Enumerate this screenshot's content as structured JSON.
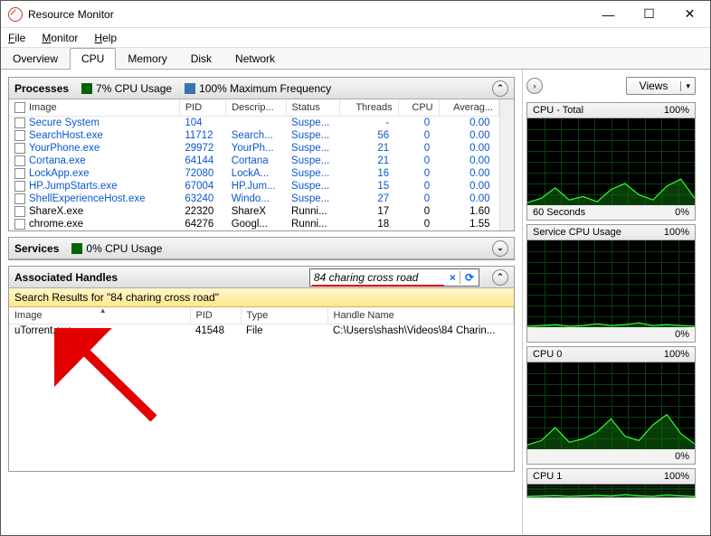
{
  "window": {
    "title": "Resource Monitor"
  },
  "menu": {
    "file": "File",
    "monitor": "Monitor",
    "help": "Help"
  },
  "tabs": {
    "overview": "Overview",
    "cpu": "CPU",
    "memory": "Memory",
    "disk": "Disk",
    "network": "Network"
  },
  "processes": {
    "title": "Processes",
    "cpu_usage_label": "7% CPU Usage",
    "max_freq_label": "100% Maximum Frequency",
    "cols": {
      "image": "Image",
      "pid": "PID",
      "desc": "Descrip...",
      "status": "Status",
      "threads": "Threads",
      "cpu": "CPU",
      "avg": "Averag..."
    },
    "rows": [
      {
        "image": "Secure System",
        "pid": "104",
        "desc": "",
        "status": "Suspe...",
        "threads": "-",
        "cpu": "0",
        "avg": "0.00",
        "link": true
      },
      {
        "image": "SearchHost.exe",
        "pid": "11712",
        "desc": "Search...",
        "status": "Suspe...",
        "threads": "56",
        "cpu": "0",
        "avg": "0.00",
        "link": true
      },
      {
        "image": "YourPhone.exe",
        "pid": "29972",
        "desc": "YourPh...",
        "status": "Suspe...",
        "threads": "21",
        "cpu": "0",
        "avg": "0.00",
        "link": true
      },
      {
        "image": "Cortana.exe",
        "pid": "64144",
        "desc": "Cortana",
        "status": "Suspe...",
        "threads": "21",
        "cpu": "0",
        "avg": "0.00",
        "link": true
      },
      {
        "image": "LockApp.exe",
        "pid": "72080",
        "desc": "LockA...",
        "status": "Suspe...",
        "threads": "16",
        "cpu": "0",
        "avg": "0.00",
        "link": true
      },
      {
        "image": "HP.JumpStarts.exe",
        "pid": "67004",
        "desc": "HP.Jum...",
        "status": "Suspe...",
        "threads": "15",
        "cpu": "0",
        "avg": "0.00",
        "link": true
      },
      {
        "image": "ShellExperienceHost.exe",
        "pid": "63240",
        "desc": "Windo...",
        "status": "Suspe...",
        "threads": "27",
        "cpu": "0",
        "avg": "0.00",
        "link": true
      },
      {
        "image": "ShareX.exe",
        "pid": "22320",
        "desc": "ShareX",
        "status": "Runni...",
        "threads": "17",
        "cpu": "0",
        "avg": "1.60",
        "link": false
      },
      {
        "image": "chrome.exe",
        "pid": "64276",
        "desc": "Googl...",
        "status": "Runni...",
        "threads": "18",
        "cpu": "0",
        "avg": "1.55",
        "link": false
      }
    ]
  },
  "services": {
    "title": "Services",
    "cpu_usage_label": "0% CPU Usage"
  },
  "handles": {
    "title": "Associated Handles",
    "search_value": "84 charing cross road",
    "results_label": "Search Results for \"84 charing cross road\"",
    "cols": {
      "image": "Image",
      "pid": "PID",
      "type": "Type",
      "name": "Handle Name"
    },
    "row": {
      "image": "uTorrent.exe",
      "pid": "41548",
      "type": "File",
      "name": "C:\\Users\\shash\\Videos\\84 Charin..."
    }
  },
  "right": {
    "views_label": "Views",
    "cpu_total": {
      "title": "CPU - Total",
      "pct": "100%",
      "footer_left": "60 Seconds",
      "footer_right": "0%"
    },
    "svc_cpu": {
      "title": "Service CPU Usage",
      "pct": "100%",
      "footer_right": "0%"
    },
    "cpu0": {
      "title": "CPU 0",
      "pct": "100%",
      "footer_right": "0%"
    },
    "cpu1": {
      "title": "CPU 1",
      "pct": "100%"
    }
  },
  "chart_data": [
    {
      "type": "line",
      "title": "CPU - Total",
      "ylim": [
        0,
        100
      ],
      "xlabel": "60 Seconds",
      "ylabel": "%",
      "x_seconds": [
        60,
        55,
        50,
        45,
        40,
        35,
        30,
        25,
        20,
        15,
        10,
        5,
        0
      ],
      "values": [
        3,
        8,
        20,
        6,
        10,
        4,
        18,
        25,
        12,
        6,
        22,
        30,
        8
      ]
    },
    {
      "type": "line",
      "title": "Service CPU Usage",
      "ylim": [
        0,
        100
      ],
      "x_seconds": [
        60,
        55,
        50,
        45,
        40,
        35,
        30,
        25,
        20,
        15,
        10,
        5,
        0
      ],
      "values": [
        1,
        2,
        3,
        1,
        2,
        4,
        2,
        3,
        5,
        2,
        3,
        2,
        1
      ]
    },
    {
      "type": "line",
      "title": "CPU 0",
      "ylim": [
        0,
        100
      ],
      "x_seconds": [
        60,
        55,
        50,
        45,
        40,
        35,
        30,
        25,
        20,
        15,
        10,
        5,
        0
      ],
      "values": [
        5,
        10,
        25,
        8,
        12,
        20,
        35,
        15,
        10,
        28,
        40,
        18,
        6
      ]
    },
    {
      "type": "line",
      "title": "CPU 1",
      "ylim": [
        0,
        100
      ],
      "x_seconds": [
        60,
        55,
        50,
        45,
        40,
        35,
        30,
        25,
        20,
        15,
        10,
        5,
        0
      ],
      "values": [
        4,
        8,
        12,
        6,
        10,
        14,
        8,
        20,
        10,
        6,
        18,
        10,
        4
      ]
    }
  ]
}
